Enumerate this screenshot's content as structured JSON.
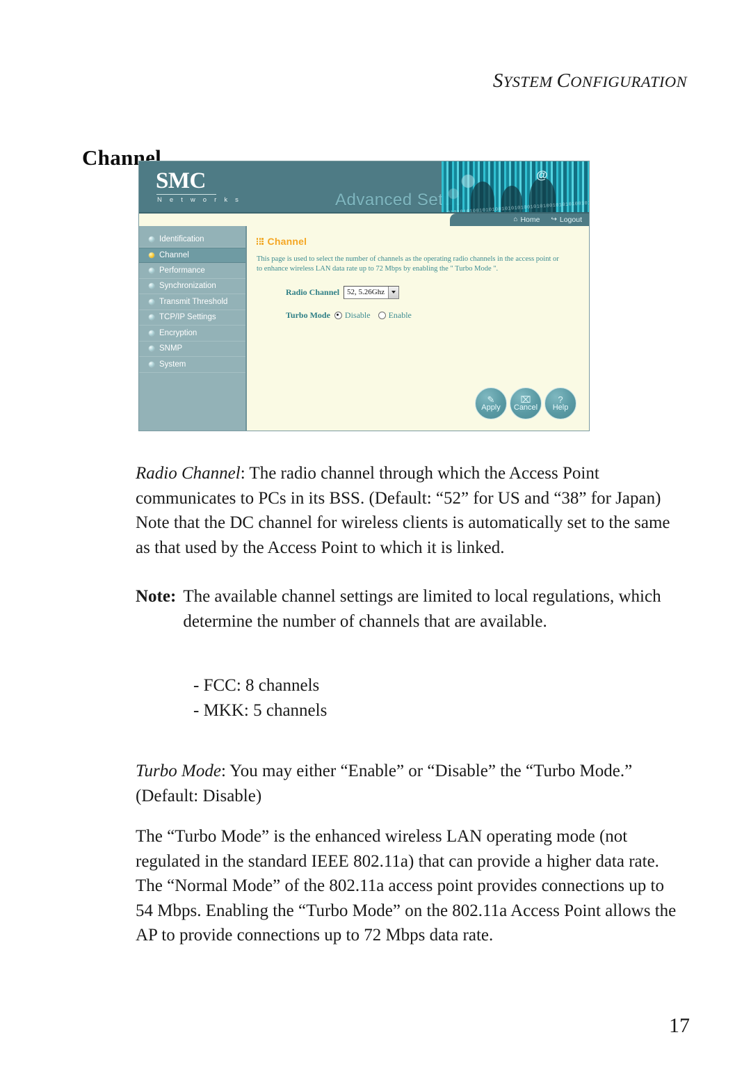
{
  "running_head": {
    "first_letter": "S",
    "rest_1": "YSTEM ",
    "first_letter_2": "C",
    "rest_2": "ONFIGURATION"
  },
  "section_title": "Channel",
  "figure": {
    "banner": {
      "logo": "SMC",
      "logo_sub": "N e t w o r k s",
      "title": "Advanced Setup",
      "art_at_symbol": "@",
      "art_binary": "010101010010101001010101001010100101010100101010"
    },
    "nav": [
      {
        "label": "Home",
        "glyph": "⌂"
      },
      {
        "label": "Logout",
        "glyph": "↪"
      }
    ],
    "sidebar": [
      {
        "label": "Identification",
        "selected": false
      },
      {
        "label": "Channel",
        "selected": true
      },
      {
        "label": "Performance",
        "selected": false
      },
      {
        "label": "Synchronization",
        "selected": false
      },
      {
        "label": "Transmit Threshold",
        "selected": false
      },
      {
        "label": "TCP/IP Settings",
        "selected": false
      },
      {
        "label": "Encryption",
        "selected": false
      },
      {
        "label": "SNMP",
        "selected": false
      },
      {
        "label": "System",
        "selected": false
      }
    ],
    "content": {
      "title": "Channel",
      "description": "This page is used to select the number of channels as the operating radio channels in the access point or to enhance wireless LAN data rate up to 72 Mbps by enabling the \" Turbo Mode \".",
      "radio_channel_label": "Radio Channel",
      "radio_channel_value": "52, 5.26Ghz",
      "turbo_mode_label": "Turbo Mode",
      "turbo_disable_label": "Disable",
      "turbo_enable_label": "Enable",
      "turbo_selected": "Disable"
    },
    "buttons": [
      {
        "label": "Apply",
        "glyph": "✎"
      },
      {
        "label": "Cancel",
        "glyph": "⌧"
      },
      {
        "label": "Help",
        "glyph": "?"
      }
    ],
    "colors": {
      "banner": "#4e7b85",
      "sidebar": "#93b2b7",
      "content_bg": "#fafae4",
      "heading_orange": "#f5a623",
      "body_teal": "#3e8d92"
    }
  },
  "body": {
    "paragraph_1_lead": "Radio Channel",
    "paragraph_1": ": The radio channel through which the Access Point communicates to PCs in its BSS. (Default: “52” for US and “38” for Japan) Note that the DC channel for wireless clients is automatically set to the same as that used by the Access Point to which it is linked.",
    "note_label": "Note:",
    "note_text": "The available channel settings are limited to local regulations, which determine the number of channels that are available.",
    "bullets": [
      "- FCC: 8 channels",
      "- MKK: 5 channels"
    ],
    "paragraph_2_lead": "Turbo Mode",
    "paragraph_2": ": You may either “Enable” or “Disable” the “Turbo Mode.” (Default: Disable)",
    "paragraph_3": "The “Turbo Mode” is the enhanced wireless LAN operating mode (not regulated in the standard IEEE 802.11a) that can provide a higher data rate. The “Normal Mode” of the 802.11a access point provides connections up to 54 Mbps. Enabling the “Turbo Mode” on the 802.11a Access Point allows the AP to provide connections up to 72 Mbps data rate."
  },
  "page_number": "17"
}
